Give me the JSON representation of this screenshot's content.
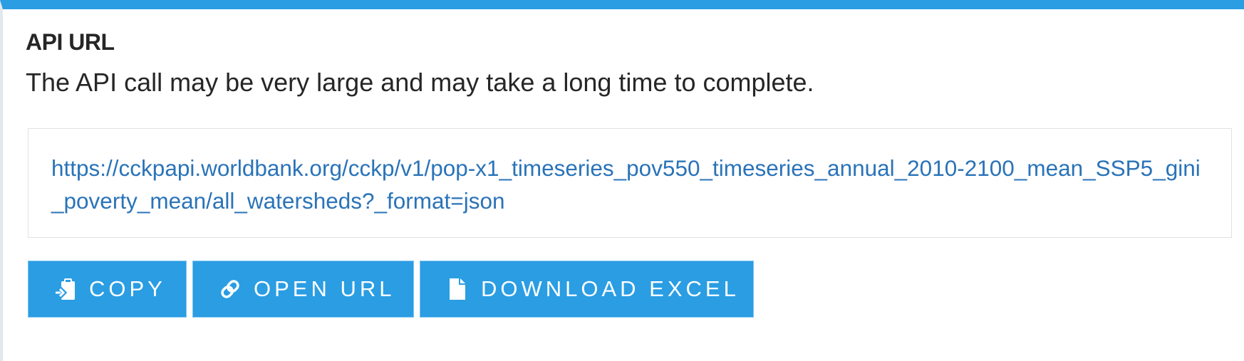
{
  "panel": {
    "title": "API URL",
    "description": "The API call may be very large and may take a long time to complete.",
    "api_url": "https://cckpapi.worldbank.org/cckp/v1/pop-x1_timeseries_pov550_timeseries_annual_2010-2100_mean_SSP5_gini_poverty_mean/all_watersheds?_format=json"
  },
  "buttons": {
    "copy": {
      "label": "COPY",
      "icon": "clipboard-copy-icon"
    },
    "open_url": {
      "label": "OPEN URL",
      "icon": "link-icon"
    },
    "download_excel": {
      "label": "DOWNLOAD EXCEL",
      "icon": "file-icon"
    }
  },
  "colors": {
    "accent": "#2a9de3",
    "link": "#2a73b8",
    "text": "#262626"
  }
}
